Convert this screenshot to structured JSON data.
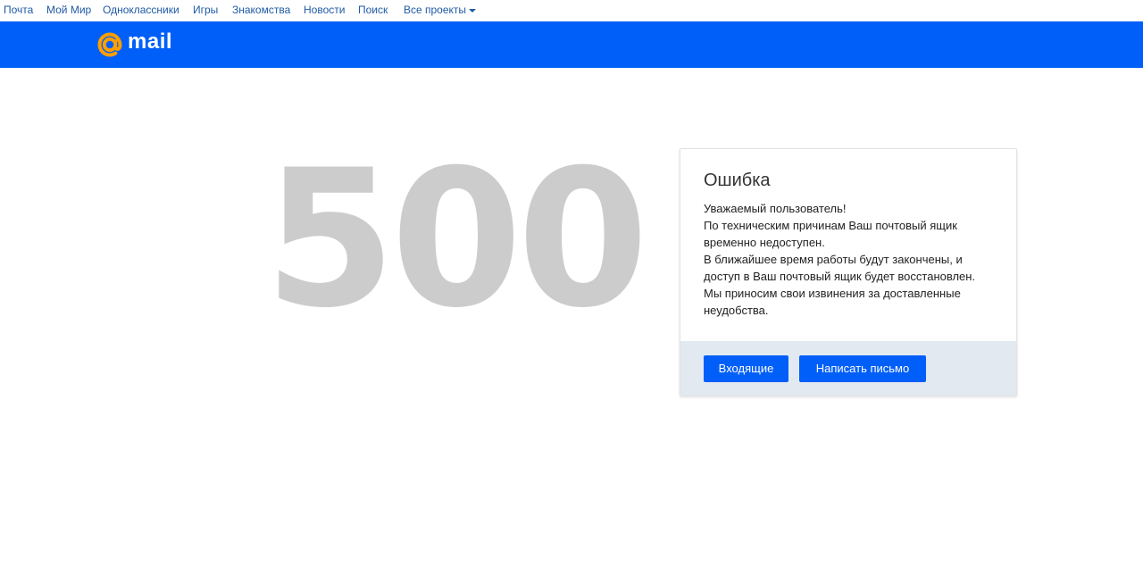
{
  "topnav": {
    "items": [
      {
        "label": "Почта"
      },
      {
        "label": "Мой Мир"
      },
      {
        "label": "Одноклассники"
      },
      {
        "label": "Игры"
      },
      {
        "label": "Знакомства"
      },
      {
        "label": "Новости"
      },
      {
        "label": "Поиск"
      },
      {
        "label": "Все проекты"
      }
    ]
  },
  "brand": {
    "logo_word": "mail",
    "bar_color": "#005ff9",
    "at_color": "#ff9e00"
  },
  "error": {
    "code": "500",
    "title": "Ошибка",
    "lines": [
      "Уважаемый пользователь!",
      "По техническим причинам Ваш почтовый ящик временно недоступен.",
      "В ближайшее время работы будут закончены, и доступ в Ваш почтовый ящик будет восстановлен.",
      "Мы приносим свои извинения за доставленные неудобства."
    ]
  },
  "buttons": {
    "inbox_label": "Входящие",
    "write_label": "Написать письмо"
  }
}
